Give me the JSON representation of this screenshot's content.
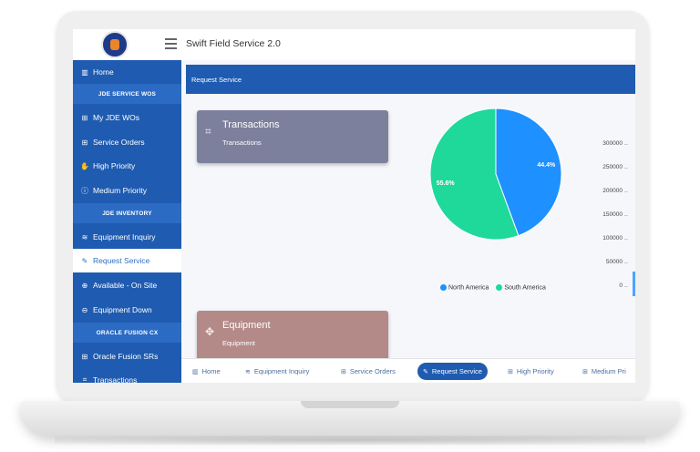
{
  "app": {
    "title": "Swift Field Service 2.0"
  },
  "sidebar": {
    "items": [
      {
        "label": "Home",
        "icon": "bar-chart-icon",
        "glyph": "▥"
      },
      {
        "label": "My JDE WOs",
        "icon": "grid-icon",
        "glyph": "⊞"
      },
      {
        "label": "Service Orders",
        "icon": "grid-icon",
        "glyph": "⊞"
      },
      {
        "label": "High Priority",
        "icon": "hand-icon",
        "glyph": "✋"
      },
      {
        "label": "Medium Priority",
        "icon": "info-circle-icon",
        "glyph": "ⓘ"
      },
      {
        "label": "Equipment Inquiry",
        "icon": "layers-icon",
        "glyph": "≋"
      },
      {
        "label": "Request Service",
        "icon": "pencil-icon",
        "glyph": "✎"
      },
      {
        "label": "Available - On Site",
        "icon": "arrow-up-circle-icon",
        "glyph": "⊕"
      },
      {
        "label": "Equipment Down",
        "icon": "arrow-down-circle-icon",
        "glyph": "⊖"
      },
      {
        "label": "Oracle Fusion SRs",
        "icon": "grid-icon",
        "glyph": "⊞"
      },
      {
        "label": "Transactions",
        "icon": "crop-icon",
        "glyph": "⌗"
      }
    ],
    "headers": [
      "JDE SERVICE WOS",
      "JDE INVENTORY",
      "ORACLE FUSION CX"
    ]
  },
  "main": {
    "banner": "Request Service",
    "cards": [
      {
        "title": "Transactions",
        "subtitle": "Transactions",
        "icon": "crop-icon",
        "glyph": "⌗",
        "color": "#7d809c"
      },
      {
        "title": "Equipment",
        "subtitle": "Equipment",
        "icon": "move-icon",
        "glyph": "✥",
        "color": "#b48a88"
      }
    ]
  },
  "chart_data": [
    {
      "type": "pie",
      "labels": [
        "North America",
        "South America"
      ],
      "values": [
        44.4,
        55.6
      ],
      "value_labels": [
        "44.4%",
        "55.6%"
      ],
      "colors": [
        "#1e90ff",
        "#1fd99a"
      ],
      "legend": "bottom"
    },
    {
      "type": "bar",
      "y_ticks": [
        "300000",
        "250000",
        "200000",
        "150000",
        "100000",
        "50000",
        "0"
      ],
      "ylim": [
        0,
        300000
      ]
    }
  ],
  "bottom_tabs": [
    {
      "label": "Home",
      "glyph": "▥",
      "icon": "bar-chart-icon"
    },
    {
      "label": "Equipment Inquiry",
      "glyph": "≋",
      "icon": "layers-icon"
    },
    {
      "label": "Service Orders",
      "glyph": "⊞",
      "icon": "grid-icon"
    },
    {
      "label": "Request Service",
      "glyph": "✎",
      "icon": "pencil-icon"
    },
    {
      "label": "High Priority",
      "glyph": "⊞",
      "icon": "grid-icon"
    },
    {
      "label": "Medium Pri",
      "glyph": "⊞",
      "icon": "grid-icon"
    }
  ]
}
